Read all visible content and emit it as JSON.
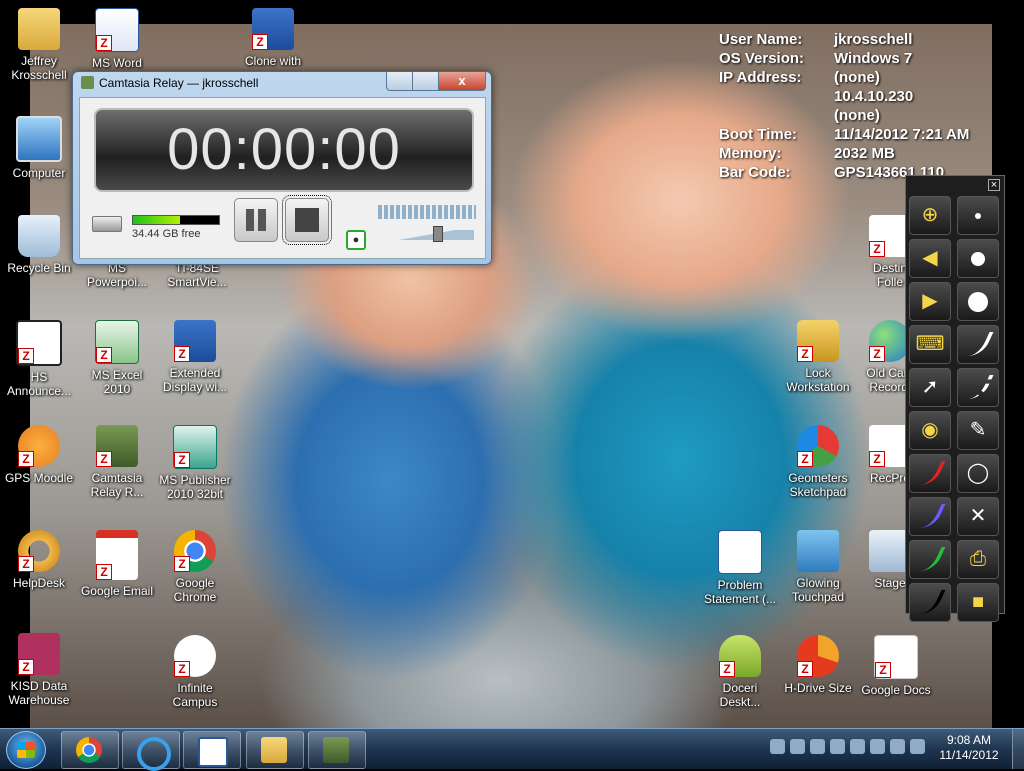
{
  "sysinfo": [
    {
      "key": "User Name:",
      "value": "jkrosschell"
    },
    {
      "key": "OS Version:",
      "value": "Windows 7"
    },
    {
      "key": "IP Address:",
      "value": "(none)"
    },
    {
      "key": "",
      "value": "10.4.10.230"
    },
    {
      "key": "",
      "value": "(none)"
    },
    {
      "key": "Boot Time:",
      "value": "11/14/2012 7:21 AM"
    },
    {
      "key": "Memory:",
      "value": "2032 MB"
    },
    {
      "key": "Bar Code:",
      "value": "GPS143661 110"
    }
  ],
  "camtasia": {
    "title": "Camtasia Relay — jkrosschell",
    "close_glyph": "x",
    "timer": "00:00:00",
    "disk_free": "34.44 GB free",
    "disk_meter_level": 0.55,
    "volume_level": 0.62
  },
  "icons": {
    "jeffrey": {
      "label": "Jeffrey Krosschell"
    },
    "msword": {
      "label": "MS Word"
    },
    "clone": {
      "label": "Clone with"
    },
    "computer": {
      "label": "Computer"
    },
    "recycle": {
      "label": "Recycle Bin"
    },
    "powerpoint": {
      "label": "MS Powerpoi..."
    },
    "ti84": {
      "label": "TI-84SE SmartVie..."
    },
    "hsannounce": {
      "label": "HS Announce..."
    },
    "excel": {
      "label": "MS Excel 2010"
    },
    "extdisplay": {
      "label": "Extended Display wi..."
    },
    "moodle": {
      "label": "GPS Moodle"
    },
    "camrelay": {
      "label": "Camtasia Relay R..."
    },
    "publisher": {
      "label": "MS Publisher 2010 32bit"
    },
    "helpdesk": {
      "label": "HelpDesk"
    },
    "gmail": {
      "label": "Google Email"
    },
    "chrome": {
      "label": "Google Chrome"
    },
    "kisd": {
      "label": "KISD Data Warehouse"
    },
    "infinite": {
      "label": "Infinite Campus"
    },
    "destiny": {
      "label": "Destin Folle"
    },
    "lock": {
      "label": "Lock Workstation"
    },
    "oldcam": {
      "label": "Old Cam Recordi"
    },
    "geometers": {
      "label": "Geometers Sketchpad"
    },
    "recpro": {
      "label": "RecPro"
    },
    "problem": {
      "label": "Problem Statement (..."
    },
    "glowing": {
      "label": "Glowing Touchpad"
    },
    "stage": {
      "label": "Stage"
    },
    "doceri": {
      "label": "Doceri Deskt..."
    },
    "hdrive": {
      "label": "H-Drive Size"
    },
    "gdocs": {
      "label": "Google Docs"
    }
  },
  "pen_toolbar": {
    "close_glyph": "×",
    "left": [
      "zoom-icon",
      "arrow-left-icon",
      "arrow-right-icon",
      "keyboard-icon",
      "pen-select-icon",
      "palette-icon",
      "red-pen-icon",
      "purple-pen-icon",
      "green-pen-icon",
      "black-pen-icon"
    ],
    "right": [
      "dot-small-icon",
      "dot-medium-icon",
      "dot-large-icon",
      "stroke-thin-icon",
      "stroke-dashed-icon",
      "eraser-icon",
      "lasso-icon",
      "clear-icon",
      "print-icon",
      "save-icon"
    ]
  },
  "taskbar": {
    "time": "9:08 AM",
    "date": "11/14/2012"
  },
  "colors": {
    "taskbar": "#1f3550",
    "timer_text": "#e6e6e6",
    "meter_green": "#1ec21e",
    "z_red": "#cc0000"
  }
}
